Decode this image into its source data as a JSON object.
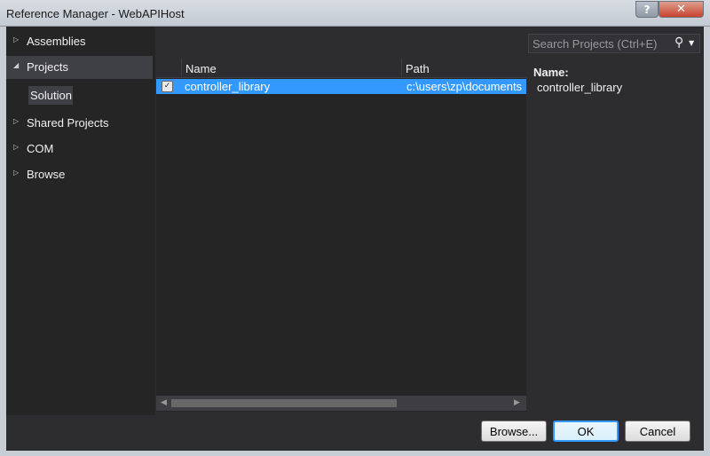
{
  "window": {
    "title": "Reference Manager - WebAPIHost",
    "help_label": "?",
    "close_label": "✕"
  },
  "nav": {
    "items": [
      {
        "label": "Assemblies",
        "arrow": "▷",
        "expanded": false
      },
      {
        "label": "Projects",
        "arrow": "◢",
        "expanded": true,
        "selected": true
      },
      {
        "label": "Shared Projects",
        "arrow": "▷",
        "expanded": false
      },
      {
        "label": "COM",
        "arrow": "▷",
        "expanded": false
      },
      {
        "label": "Browse",
        "arrow": "▷",
        "expanded": false
      }
    ],
    "sub_item": {
      "label": "Solution"
    }
  },
  "grid": {
    "columns": [
      "Name",
      "Path"
    ],
    "rows": [
      {
        "name": "controller_library",
        "path": "c:\\users\\zp\\documents",
        "selected": true
      }
    ]
  },
  "search": {
    "placeholder": "Search Projects (Ctrl+E)",
    "icon": "search-icon"
  },
  "details": {
    "name_label": "Name:",
    "name_value": "controller_library"
  },
  "buttons": {
    "browse": "Browse...",
    "ok": "OK",
    "cancel": "Cancel"
  }
}
